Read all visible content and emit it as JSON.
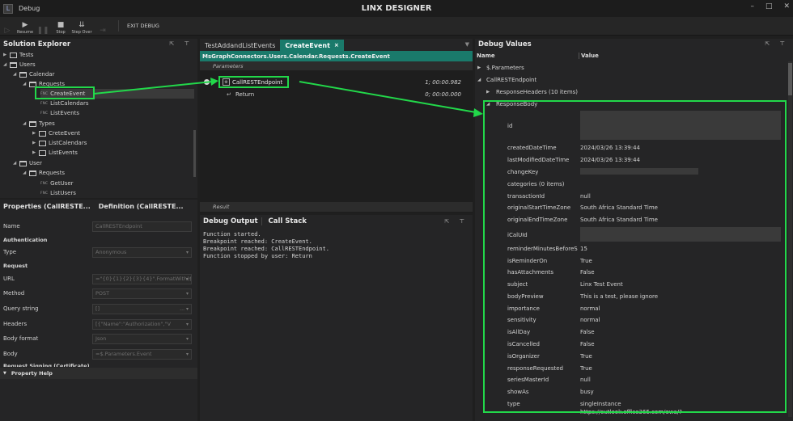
{
  "window": {
    "app_name": "Debug",
    "title": "LINX DESIGNER",
    "controls": [
      "–",
      "□",
      "✕"
    ]
  },
  "toolbar": {
    "resume": "Resume",
    "stop": "Stop",
    "step_over": "Step Over",
    "exit_debug": "EXIT DEBUG"
  },
  "solution_explorer": {
    "title": "Solution Explorer",
    "fnc_tag": "FNC",
    "items": [
      {
        "label": "Tests"
      },
      {
        "label": "Users"
      },
      {
        "label": "Calendar"
      },
      {
        "label": "Requests"
      },
      {
        "label": "CreateEvent"
      },
      {
        "label": "ListCalendars"
      },
      {
        "label": "ListEvents"
      },
      {
        "label": "Types"
      },
      {
        "label": "CreteEvent"
      },
      {
        "label": "ListCalendars"
      },
      {
        "label": "ListEvents"
      },
      {
        "label": "User"
      },
      {
        "label": "Requests"
      },
      {
        "label": "GetUser"
      },
      {
        "label": "ListUsers"
      }
    ]
  },
  "properties": {
    "tab1": "Properties (CallRESTE...",
    "tab2": "Definition (CallRESTE...",
    "name_label": "Name",
    "name_value": "CallRESTEndpoint",
    "section_auth": "Authentication",
    "type_label": "Type",
    "type_value": "Anonymous",
    "section_request": "Request",
    "url_label": "URL",
    "url_value": "=\"{0}{1}{2}{3}{4}\".FormatWith($",
    "method_label": "Method",
    "method_value": "POST",
    "query_label": "Query string",
    "query_value": "[]",
    "headers_label": "Headers",
    "headers_value": "[{\"Name\":\"Authorization\",\"V",
    "bodyformat_label": "Body format",
    "bodyformat_value": "Json",
    "body_label": "Body",
    "body_value": "=$.Parameters.Event",
    "section_signing": "Request Signing (Certificate)",
    "help": "Property Help"
  },
  "editor": {
    "tab1": "TestAddandListEvents",
    "tab2": "CreateEvent",
    "path": "MsGraphConnectors.Users.Calendar.Requests.CreateEvent",
    "parameters": "Parameters",
    "node1": "CallRESTEndpoint",
    "node1_time": "1; 00:00.982",
    "node2": "Return",
    "node2_time": "0; 00:00.000",
    "result": "Result"
  },
  "debug_output": {
    "tab1": "Debug Output",
    "tab2": "Call Stack",
    "lines": [
      "Function started.",
      "Breakpoint reached: CreateEvent.",
      "Breakpoint reached: CallRESTEndpoint.",
      "Function stopped by user: Return"
    ]
  },
  "debug_values": {
    "title": "Debug Values",
    "col_name": "Name",
    "col_value": "Value",
    "rows": [
      {
        "name": "$.Parameters",
        "value": ""
      },
      {
        "name": "CallRESTEndpoint",
        "value": ""
      },
      {
        "name": "ResponseHeaders  (10 items)",
        "value": ""
      },
      {
        "name": "ResponseBody",
        "value": ""
      },
      {
        "name": "id",
        "value": ""
      },
      {
        "name": "createdDateTime",
        "value": "2024/03/26 13:39:44"
      },
      {
        "name": "lastModifiedDateTime",
        "value": "2024/03/26 13:39:44"
      },
      {
        "name": "changeKey",
        "value": ""
      },
      {
        "name": "categories  (0 items)",
        "value": ""
      },
      {
        "name": "transactionId",
        "value": "null"
      },
      {
        "name": "originalStartTimeZone",
        "value": "South Africa Standard Time"
      },
      {
        "name": "originalEndTimeZone",
        "value": "South Africa Standard Time"
      },
      {
        "name": "iCalUId",
        "value": ""
      },
      {
        "name": "reminderMinutesBeforeS",
        "value": "15"
      },
      {
        "name": "isReminderOn",
        "value": "True"
      },
      {
        "name": "hasAttachments",
        "value": "False"
      },
      {
        "name": "subject",
        "value": "Linx Test Event"
      },
      {
        "name": "bodyPreview",
        "value": "This is a test, please ignore"
      },
      {
        "name": "importance",
        "value": "normal"
      },
      {
        "name": "sensitivity",
        "value": "normal"
      },
      {
        "name": "isAllDay",
        "value": "False"
      },
      {
        "name": "isCancelled",
        "value": "False"
      },
      {
        "name": "isOrganizer",
        "value": "True"
      },
      {
        "name": "responseRequested",
        "value": "True"
      },
      {
        "name": "seriesMasterId",
        "value": "null"
      },
      {
        "name": "showAs",
        "value": "busy"
      },
      {
        "name": "type",
        "value": "singleInstance"
      },
      {
        "name": "",
        "value": "https://outlook.office365.com/owa/?"
      }
    ]
  },
  "colors": {
    "accent_teal": "#1a7a6b",
    "highlight_green": "#22d84a"
  }
}
